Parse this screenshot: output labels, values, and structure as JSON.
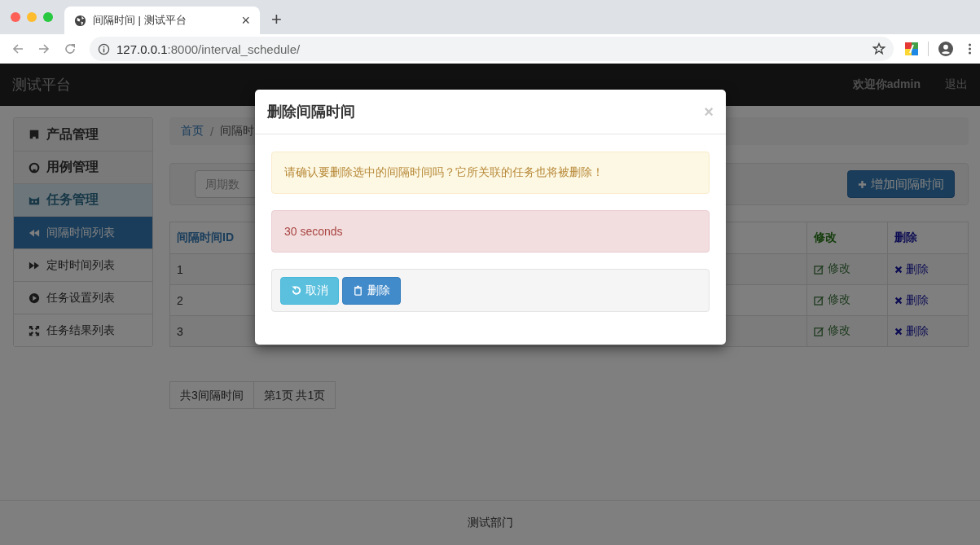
{
  "browser": {
    "tab_title": "间隔时间 | 测试平台",
    "new_tab": "+",
    "tab_close": "×",
    "url_host": "127.0.0.1",
    "url_rest": ":8000/interval_schedule/"
  },
  "navbar": {
    "brand": "测试平台",
    "user": "欢迎你admin",
    "logout": "退出"
  },
  "sidebar": {
    "items": [
      {
        "label": "产品管理",
        "kind": "group",
        "expanded": false
      },
      {
        "label": "用例管理",
        "kind": "group",
        "expanded": false
      },
      {
        "label": "任务管理",
        "kind": "group",
        "expanded": true
      },
      {
        "label": "间隔时间列表",
        "kind": "link",
        "selected": true
      },
      {
        "label": "定时时间列表",
        "kind": "link",
        "selected": false
      },
      {
        "label": "任务设置列表",
        "kind": "link",
        "selected": false
      },
      {
        "label": "任务结果列表",
        "kind": "link",
        "selected": false
      }
    ]
  },
  "breadcrumb": {
    "separator": "/",
    "items": [
      {
        "label": "首页",
        "kind": "link"
      },
      {
        "label": "间隔时",
        "kind": "current"
      }
    ]
  },
  "toolbar": {
    "search": {
      "placeholder": "周期数"
    },
    "add_button": "增加间隔时间"
  },
  "table": {
    "columns": [
      {
        "label": "间隔时间ID",
        "kind": "id"
      },
      {
        "label": "修改",
        "kind": "edit"
      },
      {
        "label": "删除",
        "kind": "delete"
      }
    ],
    "rows": [
      {
        "id": "1",
        "edit": "修改",
        "delete": "删除"
      },
      {
        "id": "2",
        "edit": "修改",
        "delete": "删除"
      },
      {
        "id": "3",
        "edit": "修改",
        "delete": "删除"
      }
    ]
  },
  "pagination": [
    "共3间隔时间",
    "第1页 共1页"
  ],
  "footer": "测试部门",
  "modal": {
    "title": "删除间隔时间",
    "close": "×",
    "warning": "请确认要删除选中的间隔时间吗？它所关联的任务也将被删除！",
    "item": "30 seconds",
    "buttons": [
      {
        "label": "取消",
        "kind": "cancel"
      },
      {
        "label": "删除",
        "kind": "delete"
      }
    ]
  }
}
